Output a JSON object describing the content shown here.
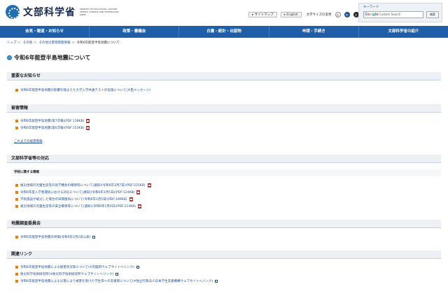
{
  "header": {
    "logo_text": "文部科学省",
    "logo_en": "MINISTRY OF EDUCATION, CULTURE, SPORTS, SCIENCE AND TECHNOLOGY-JAPAN",
    "sitemap": "サイトマップ",
    "english": "English",
    "font_size_label": "文字サイズの変更",
    "size_small": "小",
    "size_medium": "中",
    "size_large": "大"
  },
  "search": {
    "label": "キーワード",
    "placeholder": "Custom Search",
    "google": "Google",
    "button": "検索"
  },
  "nav": [
    {
      "label": "会見・報道・お知らせ"
    },
    {
      "label": "政策・審議会"
    },
    {
      "label": "白書・統計・出版物"
    },
    {
      "label": "申請・手続き"
    },
    {
      "label": "文部科学省の紹介"
    }
  ],
  "breadcrumb": [
    "トップ",
    "その他",
    "その他災害等関連情報",
    "令和6年能登半島地震について"
  ],
  "page_title": "令和6年能登半島地震について",
  "sections": {
    "notice": {
      "heading": "重要なお知らせ",
      "items": [
        "令和6年能登半島地震の影響を踏まえた大学入学共通テストの実施について(大臣メッセージ)"
      ]
    },
    "damage": {
      "heading": "被害情報",
      "items": [
        "令和6年能登半島地震(第7次報)(PDF:138KB)",
        "令和6年能登半島地震(第6次報)(PDF:153KB)"
      ],
      "more": "これまでの被害情報"
    },
    "response": {
      "heading": "文部科学省等の対応",
      "subheading": "学校に関する情報",
      "items": [
        "被災地域の児童生徒等の就学機会の確保等について(通知)(令和6年1月7日)(PDF:225KB)",
        "令和6年度入学者選抜における対応について(通知)(令和6年1月5日)(PDF:124KB)",
        "学校施設が被災した場合の早期復旧について(令和6年1月5日)(PDF:189KB)",
        "被災地域の児童生徒等の安全確保等について(通知)(令和6年1月4日)(PDF:214KB)"
      ]
    },
    "committee": {
      "heading": "地震調査委員会",
      "items": [
        "令和6年能登半島地震の評価(令和6年1月2日公表)"
      ]
    },
    "links": {
      "heading": "関連リンク",
      "items": [
        "令和6年能登半島地震による被害状況等について(※内閣府ウェブサイトへリンク)",
        "防災科学技術研究所(※防災科学技術研究所ウェブサイトへリンク)",
        "令和6年能登半島地震による災害により被害を受けた学生等への支援策について(※独立行政法人日本学生支援機構ウェブサイトへリンク)"
      ]
    }
  },
  "colors": {
    "nav_bg": "#1f5ea8",
    "link": "#1a4b8f",
    "bullet": "#e8820c",
    "pdf": "#d42a2a"
  }
}
